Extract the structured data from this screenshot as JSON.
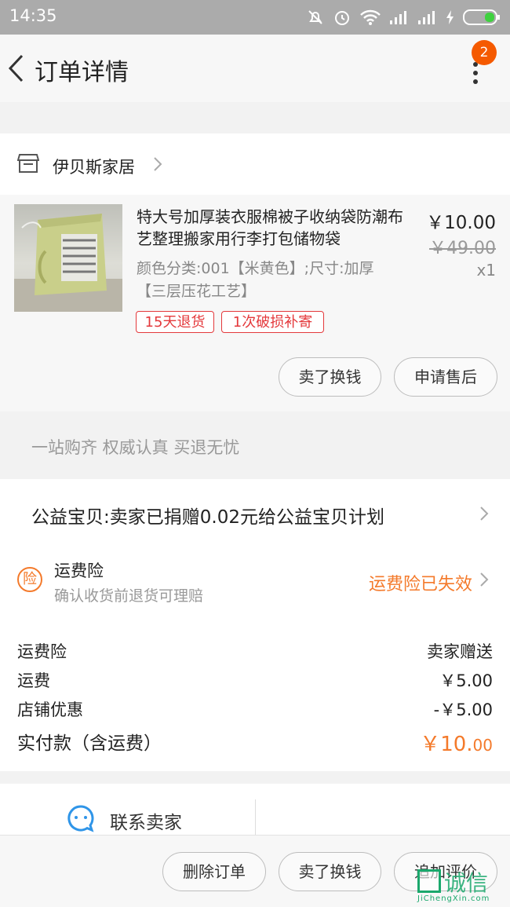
{
  "status_bar": {
    "time": "14:35"
  },
  "nav": {
    "title": "订单详情",
    "badge_count": "2"
  },
  "shop": {
    "name": "伊贝斯家居"
  },
  "product": {
    "title": "特大号加厚装衣服棉被子收纳袋防潮布艺整理搬家用行李打包储物袋",
    "sku": "颜色分类:001【米黄色】;尺寸:加厚【三层压花工艺】",
    "price": "￥10.00",
    "original_price": "￥49.00",
    "quantity": "x1",
    "tags": [
      "15天退货",
      "1次破损补寄"
    ],
    "actions": [
      "卖了换钱",
      "申请售后"
    ]
  },
  "slogan": "一站购齐 权威认真 买退无忧",
  "charity": {
    "text": "公益宝贝:卖家已捐赠0.02元给公益宝贝计划"
  },
  "insurance": {
    "icon_label": "险",
    "title": "运费险",
    "subtitle": "确认收货前退货可理赔",
    "status": "运费险已失效",
    "status_color": "#f47a2b"
  },
  "costs": [
    {
      "label": "运费险",
      "value": "卖家赠送"
    },
    {
      "label": "运费",
      "value": "￥5.00"
    },
    {
      "label": "店铺优惠",
      "value": "-￥5.00"
    }
  ],
  "total": {
    "label": "实付款（含运费）",
    "value_main": "￥10.",
    "value_cents": "00"
  },
  "contact": {
    "label": "联系卖家"
  },
  "bottom_actions": [
    "删除订单",
    "卖了换钱",
    "追加评价"
  ],
  "watermark": {
    "text": "诚信",
    "url": "JiChengXin.com"
  },
  "colors": {
    "accent": "#f47a2b",
    "tag_red": "#e4393c",
    "badge": "#f55a00"
  }
}
